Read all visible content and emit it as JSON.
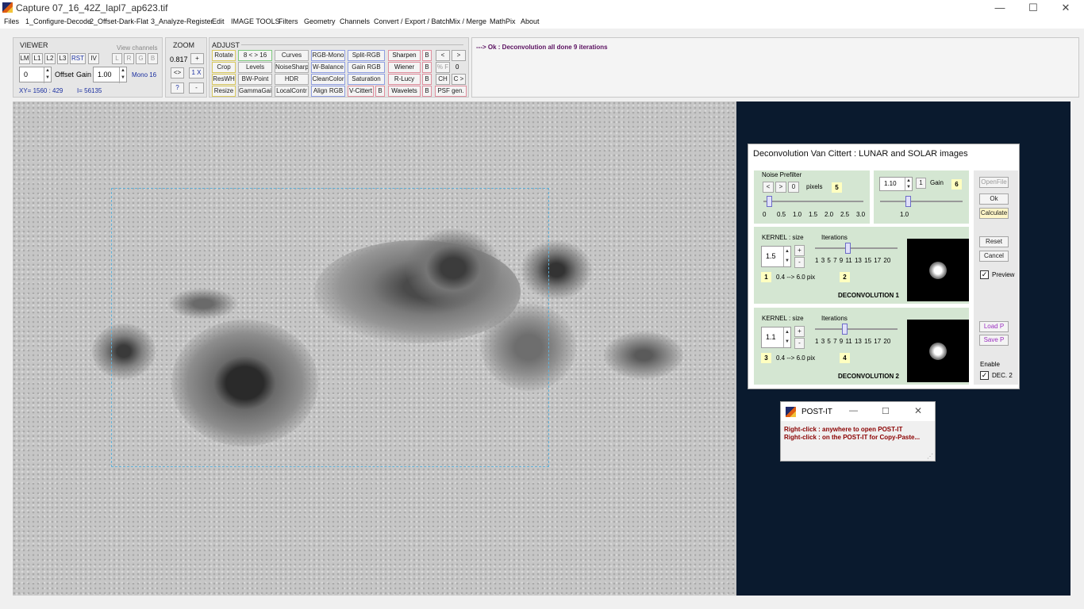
{
  "window": {
    "title": "Capture 07_16_42Z_lapl7_ap623.tif",
    "minimize": "—",
    "maximize": "☐",
    "close": "✕"
  },
  "menu": [
    "Files",
    "1_Configure-Decode",
    "2_Offset-Dark-Flat",
    "3_Analyze-Register",
    "Edit",
    "IMAGE TOOLS",
    "Filters",
    "Geometry",
    "Channels",
    "Convert / Export / Batch",
    "Mix / Merge",
    "MathPix",
    "About"
  ],
  "viewer": {
    "title": "VIEWER",
    "view_channels": "View channels",
    "buttons": [
      "LM",
      "L1",
      "L2",
      "L3",
      "RST",
      "IV"
    ],
    "channels": [
      "L",
      "R",
      "G",
      "B"
    ],
    "offset_value": "0",
    "offset_label": "Offset",
    "gain_label": "Gain",
    "gain_value": "1.00",
    "mono": "Mono 16",
    "xy": "XY=  1560 : 429",
    "intensity": "I=  56135"
  },
  "zoom": {
    "title": "ZOOM",
    "value": "0.817",
    "plus": "+",
    "fit": "<>",
    "one": "1 X",
    "help": "?",
    "minus": "-"
  },
  "adjust": {
    "title": "ADJUST",
    "col1": [
      "Rotate",
      "Crop",
      "ResWH",
      "Resize"
    ],
    "col2": [
      "8 < > 16",
      "Levels",
      "BW-Point",
      "GammaGain"
    ],
    "col3": [
      "Curves",
      "NoiseSharp",
      "HDR",
      "LocalContr"
    ],
    "col4": [
      "RGB-Mono",
      "W-Balance",
      "CleanColor",
      "Align RGB"
    ],
    "col5": [
      "Split-RGB",
      "Gain RGB",
      "Saturation",
      "V-Cittert"
    ],
    "col5_b": "B",
    "col6": [
      "Sharpen",
      "Wiener",
      "R-Lucy",
      "Wavelets"
    ],
    "col6_b": "B",
    "extra": {
      "left": "<",
      "right": ">",
      "percent": "% F",
      "zero": "0",
      "ch": "CH",
      "c_next": "C >",
      "psf": "PSF gen."
    }
  },
  "status": {
    "message": "---> Ok :  Deconvolution all done  9 iterations"
  },
  "dialog": {
    "title": "Deconvolution Van Cittert :  LUNAR and SOLAR images",
    "prefilter": {
      "label": "Noise Prefilter",
      "btn_lt": "<",
      "btn_gt": ">",
      "btn_zero": "0",
      "pixels": "pixels",
      "badge": "5",
      "ticks": [
        "0",
        "0.5",
        "1.0",
        "1.5",
        "2.0",
        "2.5",
        "3.0"
      ]
    },
    "gain": {
      "value": "1.10",
      "one": "1",
      "label": "Gain",
      "badge": "6",
      "tick": "1.0"
    },
    "dec1": {
      "kernel_label": "KERNEL :  size",
      "iterations_label": "Iterations",
      "size_value": "1.5",
      "plus": "+",
      "minus": "-",
      "iter_ticks": [
        "1",
        "3",
        "5",
        "7",
        "9",
        "11",
        "13",
        "15",
        "17",
        "20"
      ],
      "badge_size": "1",
      "range": "0.4 --> 6.0 pix",
      "badge_iter": "2",
      "title": "DECONVOLUTION 1"
    },
    "dec2": {
      "kernel_label": "KERNEL :  size",
      "iterations_label": "Iterations",
      "size_value": "1.1",
      "plus": "+",
      "minus": "-",
      "iter_ticks": [
        "1",
        "3",
        "5",
        "7",
        "9",
        "11",
        "13",
        "15",
        "17",
        "20"
      ],
      "badge_size": "3",
      "range": "0.4 --> 6.0 pix",
      "badge_iter": "4",
      "title": "DECONVOLUTION 2"
    },
    "side": {
      "openfile": "OpenFile",
      "ok": "Ok",
      "calculate": "Calculate",
      "reset": "Reset",
      "cancel": "Cancel",
      "preview": "Preview",
      "load": "Load P",
      "save": "Save P",
      "enable": "Enable",
      "dec2": "DEC. 2"
    }
  },
  "postit": {
    "title": "POST-IT",
    "line1": "Right-click : anywhere to open POST-IT",
    "line2": "Right-click : on the POST-IT for Copy-Paste..."
  }
}
